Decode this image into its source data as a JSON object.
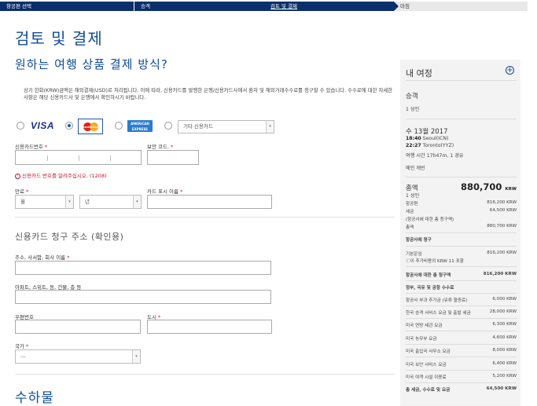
{
  "steps": [
    {
      "label": "항공편 선택",
      "state": "done"
    },
    {
      "label": "승객",
      "state": "done"
    },
    {
      "label": "검토 및 결제",
      "state": "current"
    },
    {
      "label": "마침",
      "state": "todo"
    }
  ],
  "page_title": "검토 및 결제",
  "payment": {
    "heading": "원하는 여행 상품 결제 방식?",
    "notice": "상기 한화(KRW)금액은 해외결제(USD)로 처리됩니다. 이에 따라, 신용카드를 발행한 은행/신용카드사에서 환차 및 해외거래수수료를 청구할 수 있습니다. 수수료에 대한 자세한 사항은 해당 신용카드사 및 은행에서 확인하시기 바랍니다.",
    "visa_label": "VISA",
    "mastercard_label": "MasterCard",
    "amex_label": "AMERICAN EXPRESS",
    "other_card_select": "기타 신용카드",
    "card_number_label": "신용카드번호",
    "security_code_label": "보안 코드.",
    "error_text": "신용카드 번호를 알려주십시오. (1208)",
    "expiry_label": "만료",
    "month_placeholder": "월",
    "year_placeholder": "년",
    "cardholder_label": "카드 표시 이름",
    "required_mark": "*"
  },
  "billing": {
    "heading": "신용카드 청구 주소 (확인용)",
    "address_label": "주소, 사서함, 회사 이름",
    "apt_label": "아파트, 스위트, 동, 건물, 층 등",
    "zip_label": "우편번호",
    "city_label": "도시",
    "country_label": "국가",
    "country_value": "---"
  },
  "baggage_heading": "수하물",
  "itinerary": {
    "title": "내 여정",
    "passenger_heading": "승객",
    "passenger_count": "1 성인",
    "date": "수 13월 2017",
    "depart": "18:40",
    "depart_city": "Seoul(ICN)",
    "arrive": "22:27",
    "arrive_city": "Toronto(YYZ)",
    "travel_time": "여행 시간 17h47m, 1 경유",
    "cabin": "메인 캐빈",
    "total_label": "총액",
    "total_amount": "880,700",
    "currency": "KRW",
    "total_pax": "1 성인",
    "rows": [
      {
        "k": "항공편",
        "v": "816,200 KRW"
      },
      {
        "k": "세금",
        "v": "64,500 KRW"
      }
    ],
    "airline_charges_note": "(항공사에 대한 총 청구액)",
    "total_row": {
      "k": "총액",
      "v": "880,700 KRW"
    },
    "airline_charge_heading": "항공사에 청구",
    "base_fare": {
      "k": "기본운임",
      "v": "816,200 KRW"
    },
    "addon_note": "이 추가비용의 KRW 11 포함",
    "airline_total": {
      "k": "항공사에 대한 총 청구액",
      "v": "816,200 KRW"
    },
    "tax_heading": "정부, 국유 및 공항 수수료",
    "taxes": [
      {
        "k": "항공사 부과 추가금 (유류 할증료)",
        "v": "6,000 KRW"
      },
      {
        "k": "한국 승객 서비스 요금 및 출발 세금",
        "v": "28,000 KRW"
      },
      {
        "k": "미국 연방 세관 요금",
        "v": "6,300 KRW"
      },
      {
        "k": "미국 농무부 요금",
        "v": "4,600 KRW"
      },
      {
        "k": "미국 출입국 사무소 요금",
        "v": "8,000 KRW"
      },
      {
        "k": "미국 보안 서비스 요금",
        "v": "6,400 KRW"
      },
      {
        "k": "미국 여객 시설 이용료",
        "v": "5,200 KRW"
      }
    ],
    "tax_total": {
      "k": "총 세금, 수수료 및 요금",
      "v": "64,500 KRW"
    }
  }
}
